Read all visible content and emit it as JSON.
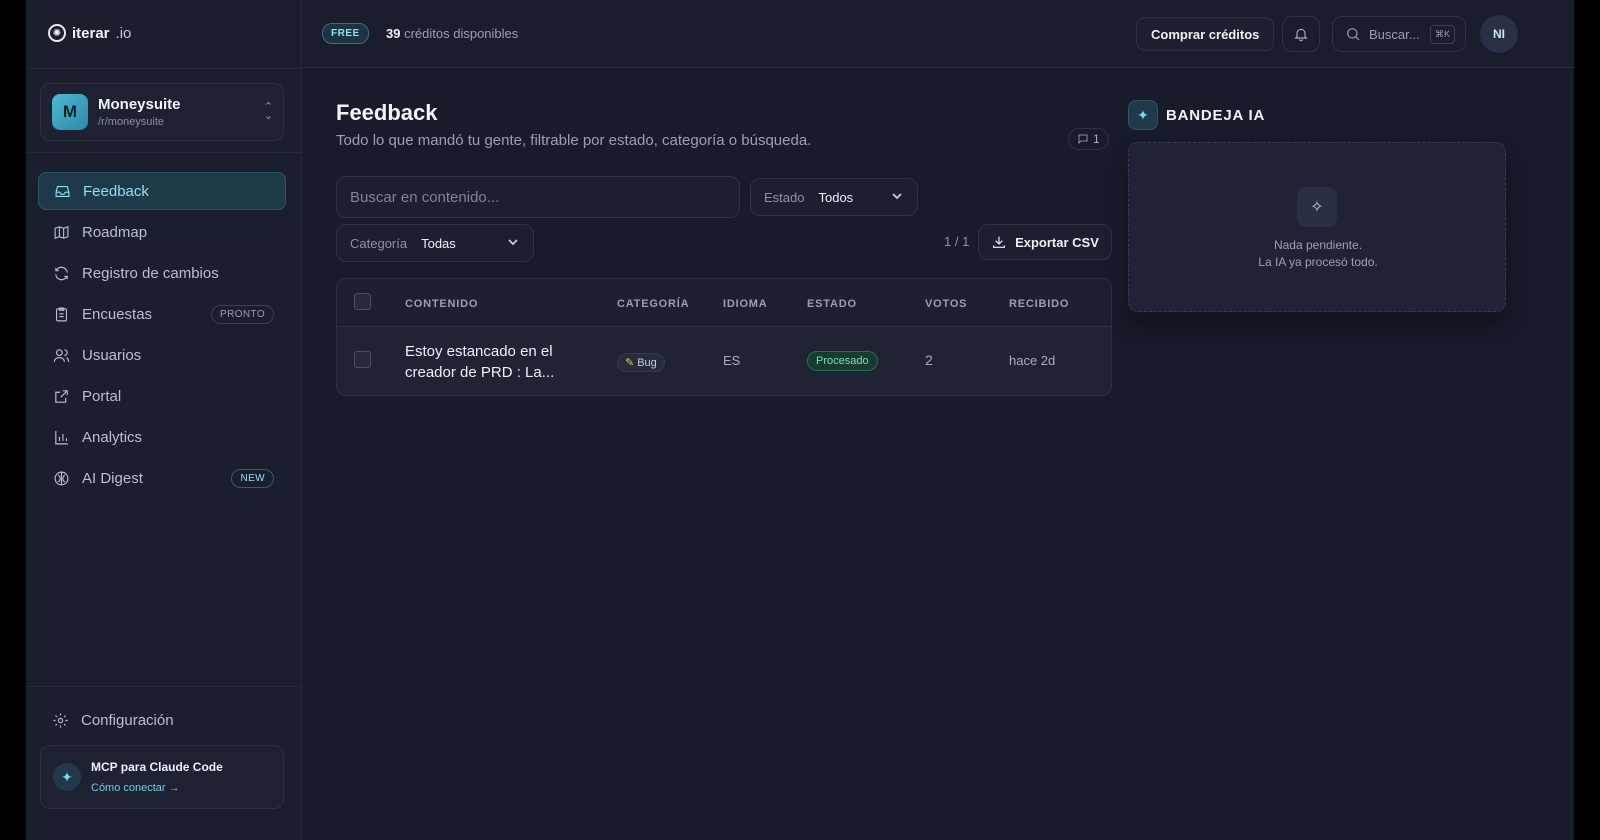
{
  "app": {
    "logo_name": "iterar",
    "logo_tld": ".io"
  },
  "workspace": {
    "initial": "M",
    "name": "Moneysuite",
    "slug": "/r/moneysuite"
  },
  "sidebar": {
    "items": [
      {
        "label": "Feedback",
        "icon": "inbox-icon",
        "active": true
      },
      {
        "label": "Roadmap",
        "icon": "map-icon"
      },
      {
        "label": "Registro de cambios",
        "icon": "refresh-icon"
      },
      {
        "label": "Encuestas",
        "icon": "clipboard-icon",
        "badge": "PRONTO"
      },
      {
        "label": "Usuarios",
        "icon": "users-icon"
      },
      {
        "label": "Portal",
        "icon": "external-link-icon"
      },
      {
        "label": "Analytics",
        "icon": "bar-chart-icon"
      },
      {
        "label": "AI Digest",
        "icon": "brain-icon",
        "badge": "NEW"
      }
    ],
    "settings_label": "Configuración",
    "mcp": {
      "title": "MCP para Claude Code",
      "link": "Cómo conectar →"
    }
  },
  "topbar": {
    "plan_badge": "FREE",
    "credits_count": "39",
    "credits_label": "créditos disponibles",
    "buy_label": "Comprar créditos",
    "search_label": "Buscar...",
    "search_shortcut": "⌘K",
    "user_initials": "NI"
  },
  "main": {
    "title": "Feedback",
    "subtitle": "Todo lo que mandó tu gente, filtrable por estado, categoría o búsqueda.",
    "comment_count": "1",
    "search_placeholder": "Buscar en contenido...",
    "estado_filter": {
      "label": "Estado",
      "value": "Todos"
    },
    "categoria_filter": {
      "label": "Categoría",
      "value": "Todas"
    },
    "pagination": "1 / 1",
    "export_label": "Exportar CSV",
    "table": {
      "headers": [
        "CONTENIDO",
        "CATEGORÍA",
        "IDIOMA",
        "ESTADO",
        "VOTOS",
        "RECIBIDO"
      ],
      "rows": [
        {
          "content": "Estoy estancado en el creador de PRD : La...",
          "category": "Bug",
          "language": "ES",
          "status": "Procesado",
          "votes": "2",
          "received": "hace 2d"
        }
      ]
    }
  },
  "ai_inbox": {
    "title": "BANDEJA IA",
    "empty_line1": "Nada pendiente.",
    "empty_line2": "La IA ya procesó todo."
  },
  "colors": {
    "accent": "#8fe0f1",
    "background": "#181b2a",
    "sidebar": "#1a1e2d",
    "status_ok": "#7be0b0"
  }
}
